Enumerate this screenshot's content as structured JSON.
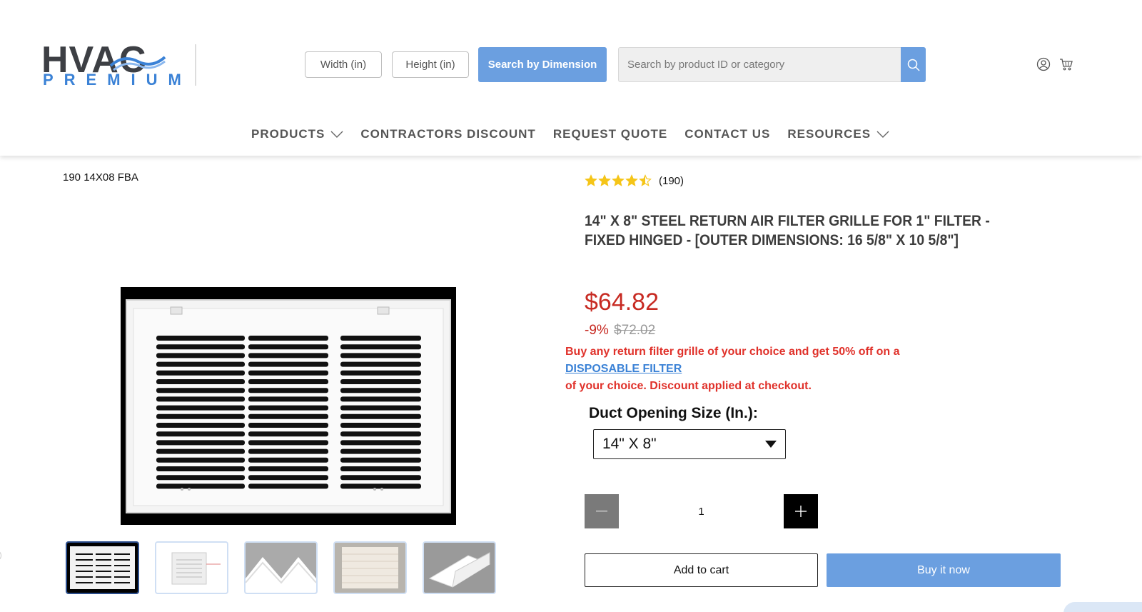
{
  "colors": {
    "accent": "#6b9fe0",
    "price": "#c72a22",
    "promo": "#e0312a",
    "brand_blue": "#3b82d6",
    "star": "#f5c518"
  },
  "header": {
    "logo_top": "HVAC",
    "logo_bottom": "PREMIUM",
    "width_placeholder": "Width (in)",
    "height_placeholder": "Height (in)",
    "search_by_dimension": "Search by Dimension",
    "search_placeholder": "Search by product ID or category",
    "icons": [
      "search-icon",
      "account-icon",
      "cart-icon"
    ]
  },
  "nav": [
    {
      "label": "PRODUCTS",
      "has_dropdown": true
    },
    {
      "label": "CONTRACTORS DISCOUNT",
      "has_dropdown": false
    },
    {
      "label": "REQUEST QUOTE",
      "has_dropdown": false
    },
    {
      "label": "CONTACT US",
      "has_dropdown": false
    },
    {
      "label": "RESOURCES",
      "has_dropdown": true
    }
  ],
  "product": {
    "sku": "190 14X08 FBA",
    "rating": 4.5,
    "review_count": "(190)",
    "title": "14\" X 8\" STEEL RETURN AIR FILTER GRILLE FOR 1\" FILTER - FIXED HINGED - [OUTER DIMENSIONS: 16 5/8\" X 10 5/8\"]",
    "price": "$64.82",
    "discount_pct": "-9%",
    "old_price": "$72.02",
    "promo_line1": "Buy any return filter grille of your choice and get 50% off on a",
    "promo_link": "DISPOSABLE FILTER",
    "promo_line2": "of your choice. Discount applied at checkout.",
    "size_label": "Duct Opening Size (In.):",
    "size_value": "14\" X 8\"",
    "quantity": "1",
    "add_to_cart": "Add to cart",
    "buy_now": "Buy it now",
    "thumbnail_count": 5
  }
}
